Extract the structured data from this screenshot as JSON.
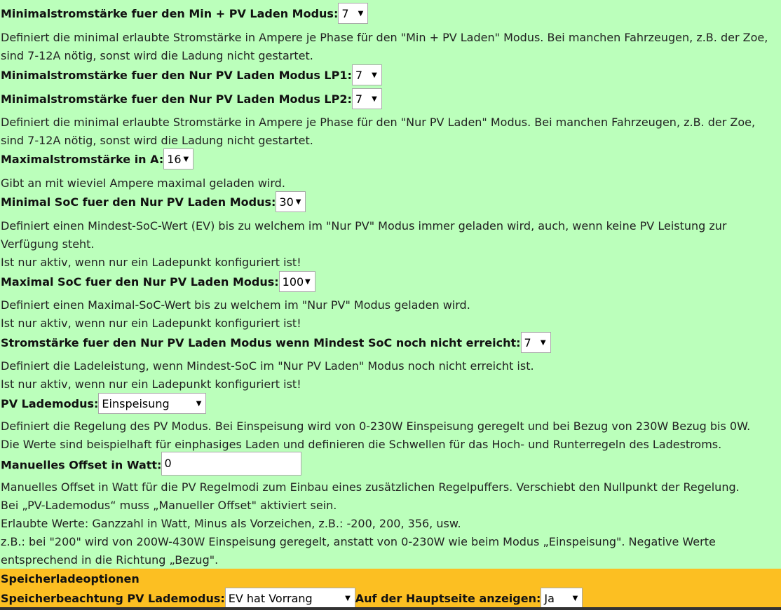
{
  "settings": {
    "min_pv": {
      "label": "Minimalstromstärke fuer den Min + PV Laden Modus:",
      "value": "7"
    },
    "min_pv_desc": "Definiert die minimal erlaubte Stromstärke in Ampere je Phase für den \"Min + PV Laden\" Modus. Bei manchen Fahrzeugen, z.B. der Zoe, sind 7-12A nötig, sonst wird die Ladung nicht gestartet.",
    "nur_pv_lp1": {
      "label": "Minimalstromstärke fuer den Nur PV Laden Modus LP1:",
      "value": "7"
    },
    "nur_pv_lp2": {
      "label": "Minimalstromstärke fuer den Nur PV Laden Modus LP2:",
      "value": "7"
    },
    "nur_pv_desc": "Definiert die minimal erlaubte Stromstärke in Ampere je Phase für den \"Nur PV Laden\" Modus. Bei manchen Fahrzeugen, z.B. der Zoe, sind 7-12A nötig, sonst wird die Ladung nicht gestartet.",
    "max_a": {
      "label": "Maximalstromstärke in A:",
      "value": "16"
    },
    "max_a_desc": "Gibt an mit wieviel Ampere maximal geladen wird.",
    "min_soc": {
      "label": "Minimal SoC fuer den Nur PV Laden Modus:",
      "value": "30"
    },
    "min_soc_desc1": "Definiert einen Mindest-SoC-Wert (EV) bis zu welchem im \"Nur PV\" Modus immer geladen wird, auch, wenn keine PV Leistung zur Verfügung steht.",
    "min_soc_desc2": "Ist nur aktiv, wenn nur ein Ladepunkt konfiguriert ist!",
    "max_soc": {
      "label": "Maximal SoC fuer den Nur PV Laden Modus:",
      "value": "100"
    },
    "max_soc_desc1": "Definiert einen Maximal-SoC-Wert bis zu welchem im \"Nur PV\" Modus geladen wird.",
    "max_soc_desc2": "Ist nur aktiv, wenn nur ein Ladepunkt konfiguriert ist!",
    "soc_current": {
      "label": "Stromstärke fuer den Nur PV Laden Modus wenn Mindest SoC noch nicht erreicht:",
      "value": "7"
    },
    "soc_current_desc1": "Definiert die Ladeleistung, wenn Mindest-SoC im \"Nur PV Laden\" Modus noch nicht erreicht ist.",
    "soc_current_desc2": "Ist nur aktiv, wenn nur ein Ladepunkt konfiguriert ist!",
    "pv_mode": {
      "label": "PV Lademodus:",
      "value": "Einspeisung"
    },
    "pv_mode_desc1": "Definiert die Regelung des PV Modus. Bei Einspeisung wird von 0-230W Einspeisung geregelt und bei Bezug von 230W Bezug bis 0W.",
    "pv_mode_desc2": "Die Werte sind beispielhaft für einphasiges Laden und definieren die Schwellen für das Hoch- und Runterregeln des Ladestroms.",
    "offset": {
      "label": "Manuelles Offset in Watt:",
      "value": "0"
    },
    "offset_desc1": "Manuelles Offset in Watt für die PV Regelmodi zum Einbau eines zusätzlichen Regelpuffers. Verschiebt den Nullpunkt der Regelung.",
    "offset_desc2": "Bei „PV-Lademodus“ muss „Manueller Offset\" aktiviert sein.",
    "offset_desc3": "Erlaubte Werte: Ganzzahl in Watt, Minus als Vorzeichen, z.B.: -200, 200, 356, usw.",
    "offset_desc4": "z.B.: bei \"200\" wird von 200W-430W Einspeisung geregelt, anstatt von 0-230W wie beim Modus „Einspeisung\". Negative Werte entsprechend in die Richtung „Bezug\"."
  },
  "storage": {
    "heading": "Speicherladeoptionen",
    "mode": {
      "label": "Speicherbeachtung PV Lademodus:",
      "value": "EV hat Vorrang"
    },
    "show": {
      "label": "Auf der Hauptseite anzeigen:",
      "value": "Ja"
    }
  },
  "colors": {
    "green_bg": "#bbffbb",
    "orange_bg": "#fcbf22"
  }
}
